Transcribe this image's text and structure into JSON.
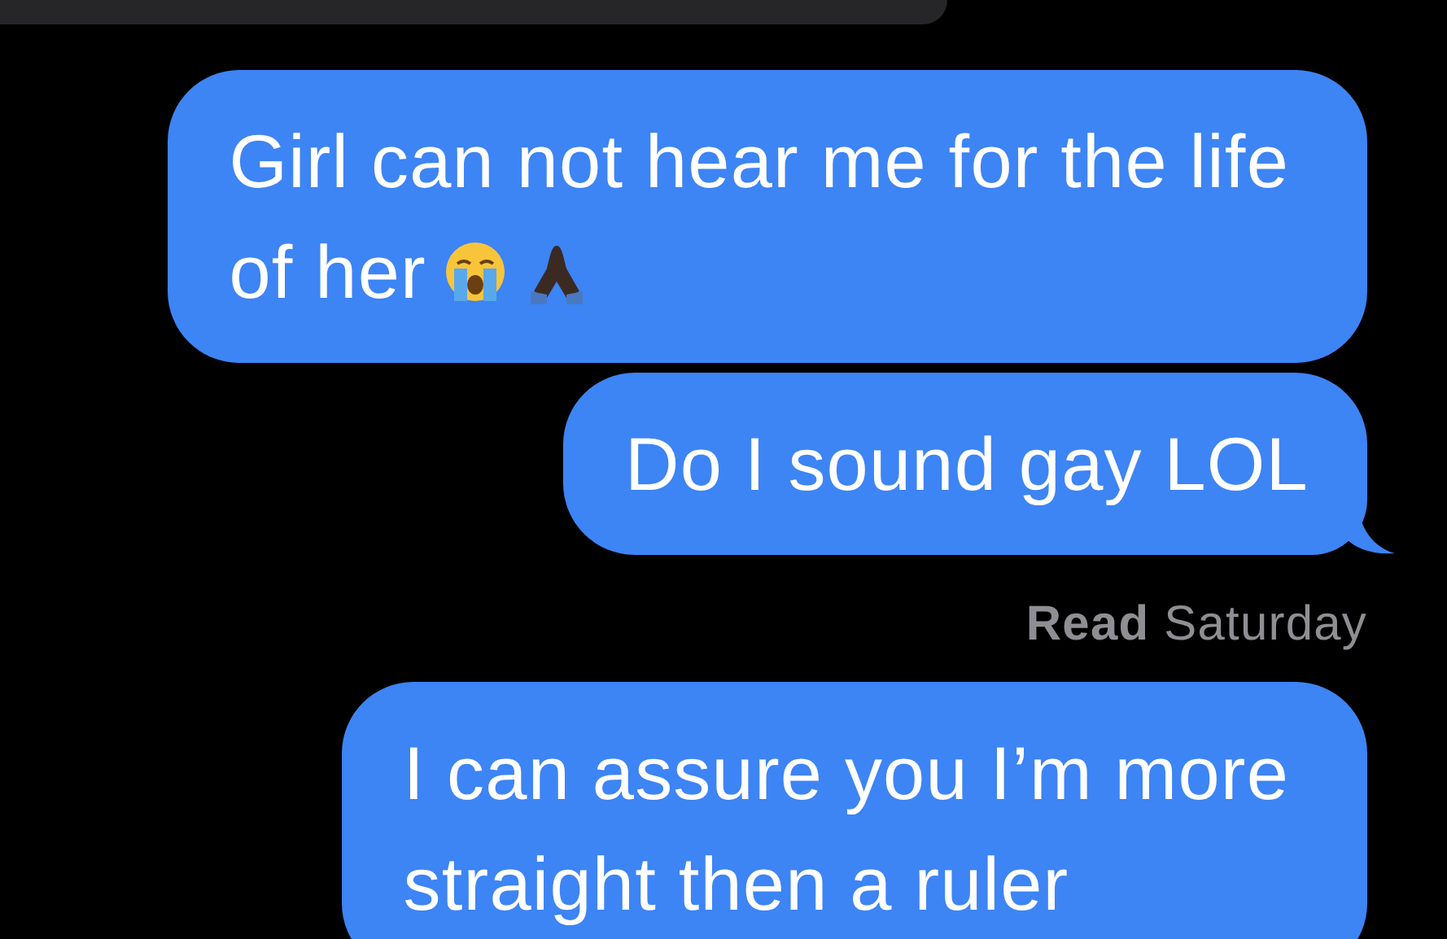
{
  "messages": [
    {
      "kind": "received"
    },
    {
      "kind": "sent",
      "lines": [
        "Girl can not hear me for the life",
        "of her"
      ],
      "icons": [
        {
          "kind": "crying-face"
        },
        {
          "kind": "praying-hands"
        }
      ],
      "tail": false
    },
    {
      "kind": "sent",
      "lines": [
        "Do I sound gay LOL"
      ],
      "tail": true
    },
    {
      "kind": "receipt",
      "text": "**Read** Saturday"
    },
    {
      "kind": "sent",
      "lines": [
        "I can assure you I’m more",
        "straight then a ruler"
      ],
      "tail": false
    }
  ]
}
